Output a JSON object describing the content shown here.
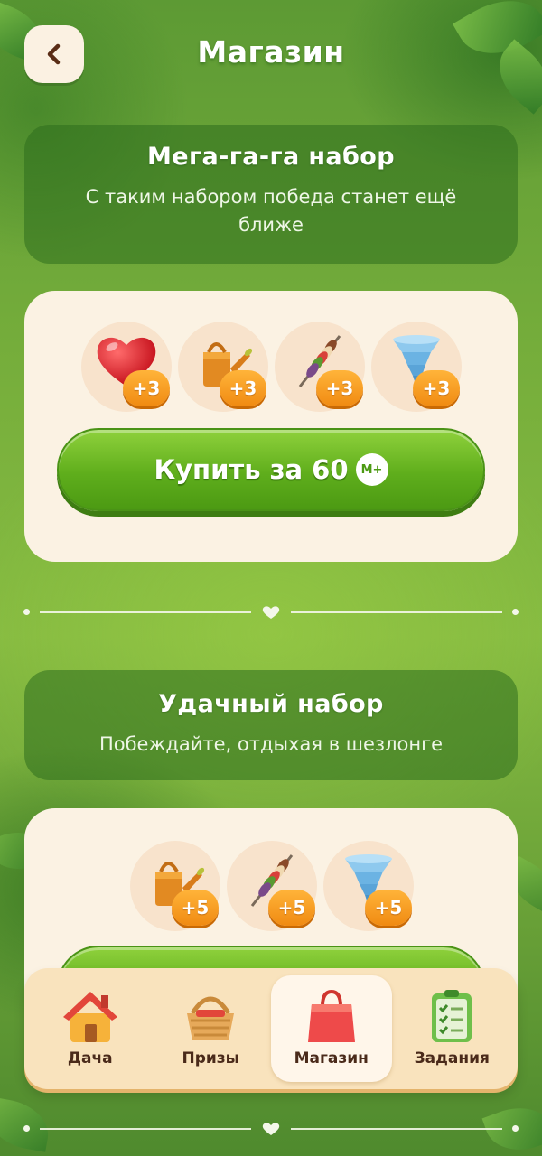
{
  "header": {
    "title": "Магазин",
    "back_icon": "chevron-left-icon"
  },
  "bundles": [
    {
      "title": "Мега-га-га набор",
      "description": "С таким набором победа станет ещё ближе",
      "items": [
        {
          "icon": "heart-icon",
          "amount": "+3"
        },
        {
          "icon": "watering-can-icon",
          "amount": "+3"
        },
        {
          "icon": "skewer-icon",
          "amount": "+3"
        },
        {
          "icon": "tornado-icon",
          "amount": "+3"
        }
      ],
      "buy_label": "Купить за 60",
      "currency": "М+"
    },
    {
      "title": "Удачный набор",
      "description": "Побеждайте, отдыхая в шезлонге",
      "items": [
        {
          "icon": "watering-can-icon",
          "amount": "+5"
        },
        {
          "icon": "skewer-icon",
          "amount": "+5"
        },
        {
          "icon": "tornado-icon",
          "amount": "+5"
        }
      ]
    }
  ],
  "bottom_nav": [
    {
      "label": "Дача",
      "icon": "house-icon",
      "active": false
    },
    {
      "label": "Призы",
      "icon": "basket-icon",
      "active": false
    },
    {
      "label": "Магазин",
      "icon": "shopping-bag-icon",
      "active": true
    },
    {
      "label": "Задания",
      "icon": "checklist-icon",
      "active": false
    }
  ],
  "colors": {
    "accent_green": "#5fae1c",
    "badge_orange": "#f08a12",
    "card_bg": "#fbf2e3",
    "nav_bg": "#f9e3bd"
  }
}
